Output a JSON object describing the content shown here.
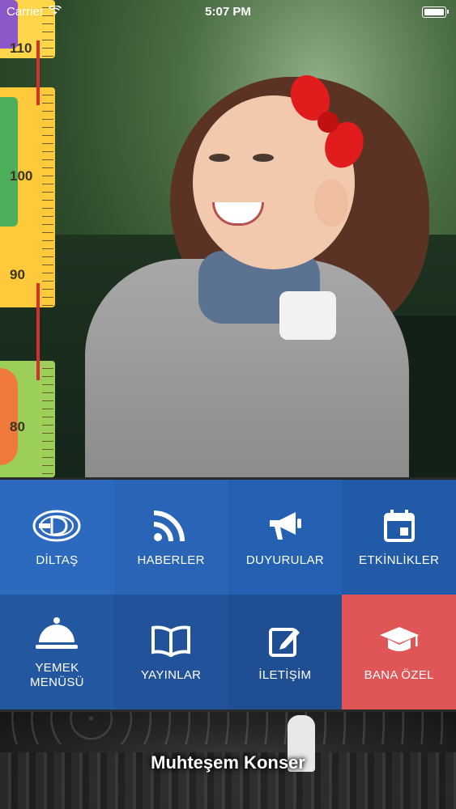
{
  "status_bar": {
    "carrier": "Carrier",
    "time": "5:07 PM"
  },
  "hero": {
    "ruler_numbers": [
      "110",
      "100",
      "90",
      "80"
    ]
  },
  "menu": {
    "tiles": [
      {
        "label": "DİLTAŞ",
        "icon": "diltas-logo-icon"
      },
      {
        "label": "HABERLER",
        "icon": "rss-icon"
      },
      {
        "label": "DUYURULAR",
        "icon": "megaphone-icon"
      },
      {
        "label": "ETKİNLİKLER",
        "icon": "calendar-icon"
      },
      {
        "label": "YEMEK\nMENÜSÜ",
        "icon": "food-cloche-icon"
      },
      {
        "label": "YAYINLAR",
        "icon": "book-icon"
      },
      {
        "label": "İLETİŞİM",
        "icon": "edit-icon"
      },
      {
        "label": "BANA ÖZEL",
        "icon": "graduation-cap-icon"
      }
    ]
  },
  "banner": {
    "title": "Muhteşem Konser"
  },
  "colors": {
    "tile_blue": "#2c6ac0",
    "bana_ozel_red": "#e05656"
  }
}
